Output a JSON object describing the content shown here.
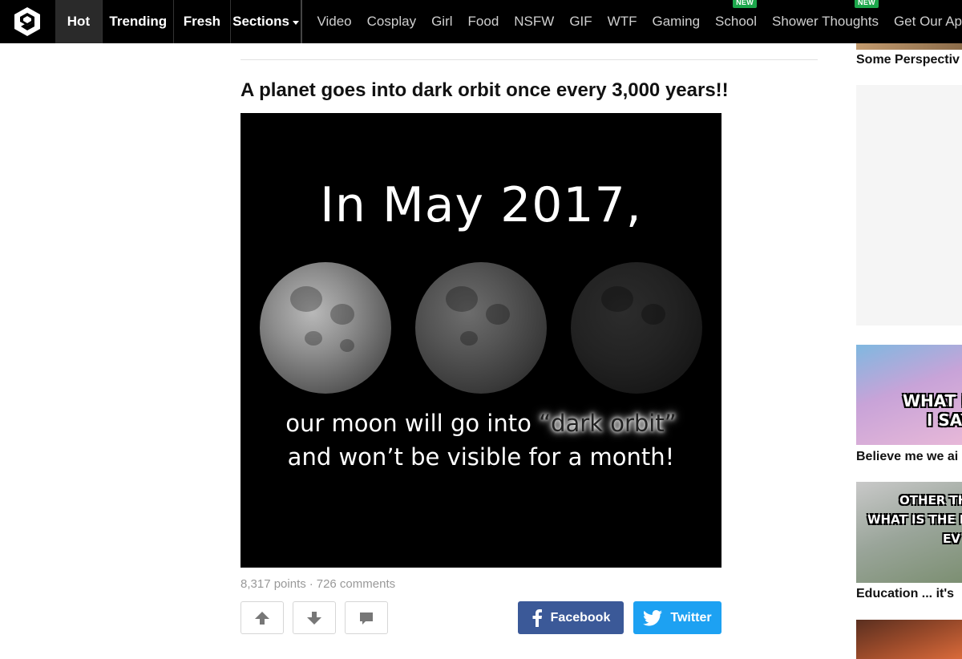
{
  "nav": {
    "tabs": [
      {
        "label": "Hot",
        "active": true
      },
      {
        "label": "Trending",
        "active": false
      },
      {
        "label": "Fresh",
        "active": false
      },
      {
        "label": "Sections",
        "active": false
      }
    ],
    "sections": [
      {
        "label": "Video"
      },
      {
        "label": "Cosplay"
      },
      {
        "label": "Girl"
      },
      {
        "label": "Food"
      },
      {
        "label": "NSFW"
      },
      {
        "label": "GIF"
      },
      {
        "label": "WTF"
      },
      {
        "label": "Gaming"
      },
      {
        "label": "School",
        "badge": "NEW"
      },
      {
        "label": "Shower Thoughts",
        "badge": "NEW"
      },
      {
        "label": "Get Our Ap"
      }
    ],
    "logo_icon": "9gag-logo-icon",
    "dropdown_icon": "caret-down-icon"
  },
  "post": {
    "title": "A planet goes into dark orbit once every 3,000 years!!",
    "image_text": {
      "line1": "In May 2017,",
      "line2_prefix": "our moon will go into ",
      "line2_highlight": "“dark orbit”",
      "line3": "and won’t be visible for a month!"
    },
    "points": "8,317 points",
    "separator": "·",
    "comments": "726 comments",
    "upvote_icon": "arrow-up-icon",
    "downvote_icon": "arrow-down-icon",
    "comment_icon": "comment-icon",
    "share": {
      "facebook_label": "Facebook",
      "twitter_label": "Twitter",
      "facebook_color": "#3b5998",
      "twitter_color": "#1da1f2"
    }
  },
  "sidebar": {
    "items": [
      {
        "title": "Some Perspectiv"
      },
      {
        "title": "Believe me we ai",
        "meme_lines": [
          "WHAT PE",
          "I SAY"
        ]
      },
      {
        "title": "Education ... it's",
        "meme_lines": [
          "OTHER THA",
          "WHAT IS THE MOS",
          "EV"
        ]
      }
    ]
  },
  "colors": {
    "nav_bg": "#000000",
    "new_badge": "#1ca74b"
  }
}
